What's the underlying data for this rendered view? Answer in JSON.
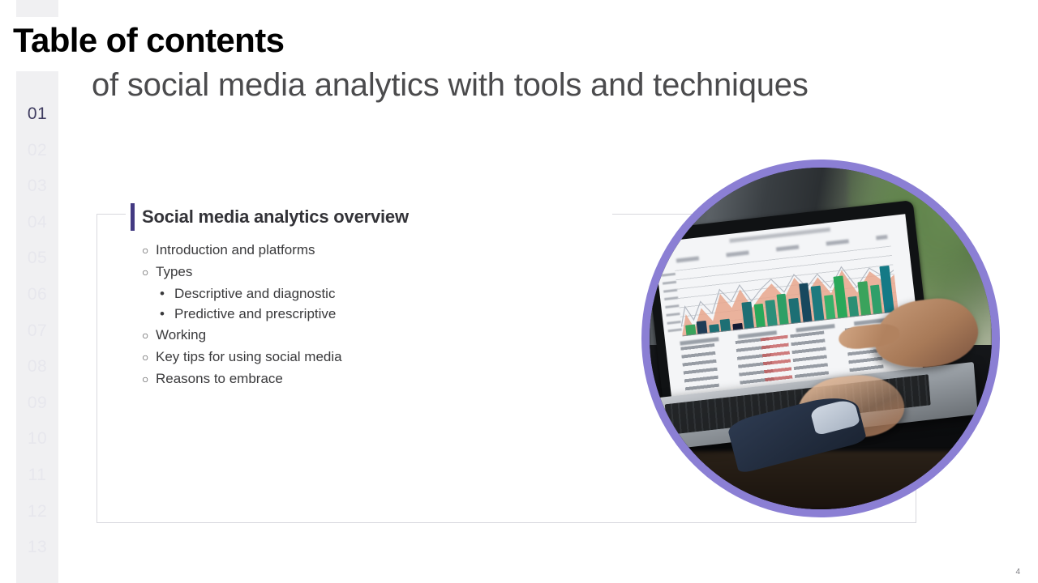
{
  "slide": {
    "title": "Table of contents",
    "subtitle": "of social media analytics with tools and techniques",
    "page_number": "4"
  },
  "rail": {
    "active_index": 0,
    "items": [
      {
        "label": "01"
      },
      {
        "label": "02"
      },
      {
        "label": "03"
      },
      {
        "label": "04"
      },
      {
        "label": "05"
      },
      {
        "label": "06"
      },
      {
        "label": "07"
      },
      {
        "label": "08"
      },
      {
        "label": "09"
      },
      {
        "label": "10"
      },
      {
        "label": "11"
      },
      {
        "label": "12"
      },
      {
        "label": "13"
      }
    ]
  },
  "card": {
    "heading": "Social media analytics overview",
    "bullets": [
      {
        "level": 1,
        "marker": "○",
        "text": "Introduction and platforms"
      },
      {
        "level": 1,
        "marker": "○",
        "text": "Types"
      },
      {
        "level": 2,
        "marker": "•",
        "text": "Descriptive and diagnostic"
      },
      {
        "level": 2,
        "marker": "•",
        "text": "Predictive and prescriptive"
      },
      {
        "level": 1,
        "marker": "○",
        "text": "Working"
      },
      {
        "level": 1,
        "marker": "○",
        "text": "Key tips for using social media"
      },
      {
        "level": 1,
        "marker": "○",
        "text": "Reasons to embrace"
      }
    ]
  },
  "photo": {
    "alt": "person-using-laptop-with-analytics-dashboard",
    "ring_color": "#8b7fd4"
  },
  "colors": {
    "accent_bar": "#433a82",
    "rail_background": "#f0f0f2",
    "rail_active_text": "#3f3c60",
    "rail_inactive_text": "#e7e7ed",
    "title_text": "#000000",
    "subtitle_text": "#4b4b4d",
    "body_text": "#3a3a3c",
    "card_border": "#d8d8de"
  },
  "chart_data": {
    "type": "bar",
    "title": "",
    "note": "Blurred dashboard on laptop screen: teal/green bar series with a salmon area overlay and a line series.",
    "categories": [
      "1",
      "2",
      "3",
      "4",
      "5",
      "6",
      "7",
      "8",
      "9",
      "10",
      "11",
      "12",
      "13",
      "14",
      "15",
      "16",
      "17",
      "18"
    ],
    "series": [
      {
        "name": "bars",
        "values": [
          18,
          22,
          14,
          20,
          11,
          46,
          40,
          44,
          52,
          43,
          66,
          60,
          42,
          72,
          35,
          58,
          50,
          80
        ],
        "colors": [
          "#3aa35c",
          "#1f3d57",
          "#1d6f74",
          "#1d6f74",
          "#141a33",
          "#1d6f74",
          "#2aa85a",
          "#2d8f7a",
          "#2e9f66",
          "#1d6f74",
          "#17485e",
          "#1d7a7e",
          "#37b06a",
          "#2aa85a",
          "#2b8f74",
          "#3aa35c",
          "#2f9f6a",
          "#147a86"
        ]
      },
      {
        "name": "area",
        "values": [
          4,
          26,
          12,
          30,
          18,
          50,
          34,
          52,
          28,
          44,
          56,
          38,
          62,
          40,
          58,
          36,
          64,
          30
        ],
        "color": "#e8a68c"
      },
      {
        "name": "line",
        "values": [
          10,
          30,
          16,
          34,
          24,
          52,
          40,
          56,
          33,
          48,
          60,
          45,
          66,
          46,
          62,
          43,
          70,
          38
        ],
        "color": "#b8bcc4"
      }
    ],
    "xlabel": "",
    "ylabel": "",
    "grid": true,
    "legend": "none"
  }
}
